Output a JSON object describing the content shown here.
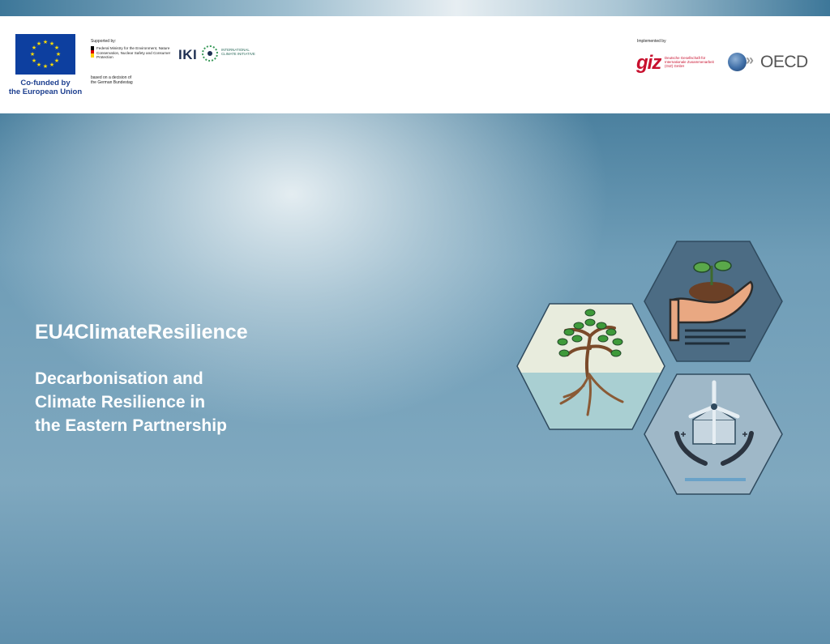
{
  "header": {
    "eu_caption": "Co-funded by\nthe European Union",
    "supported_by": "Supported by:",
    "ministry_text": "Federal Ministry for the Environment, Nature Conservation, Nuclear Safety and Consumer Protection",
    "bundestag_text": "based on a decision of the German Bundestag",
    "iki_mark": "IKI",
    "iki_text": "INTERNATIONAL CLIMATE INITIATIVE",
    "implemented_by": "Implemented by",
    "giz_mark": "giz",
    "giz_text": "Deutsche Gesellschaft für Internationale Zusammenarbeit (GIZ) GmbH",
    "oecd_text": "OECD",
    "colors": {
      "eu_blue": "#0d3f9f",
      "eu_star": "#ffdd00",
      "giz_red": "#c8102e",
      "iki_navy": "#1e2f52"
    }
  },
  "main": {
    "title": "EU4ClimateResilience",
    "subtitle": "Decarbonisation and\nClimate Resilience in\nthe Eastern Partnership"
  },
  "illustrations": [
    {
      "icon": "tree-roots-icon"
    },
    {
      "icon": "hand-sprout-icon"
    },
    {
      "icon": "wind-turbine-hands-icon"
    }
  ]
}
